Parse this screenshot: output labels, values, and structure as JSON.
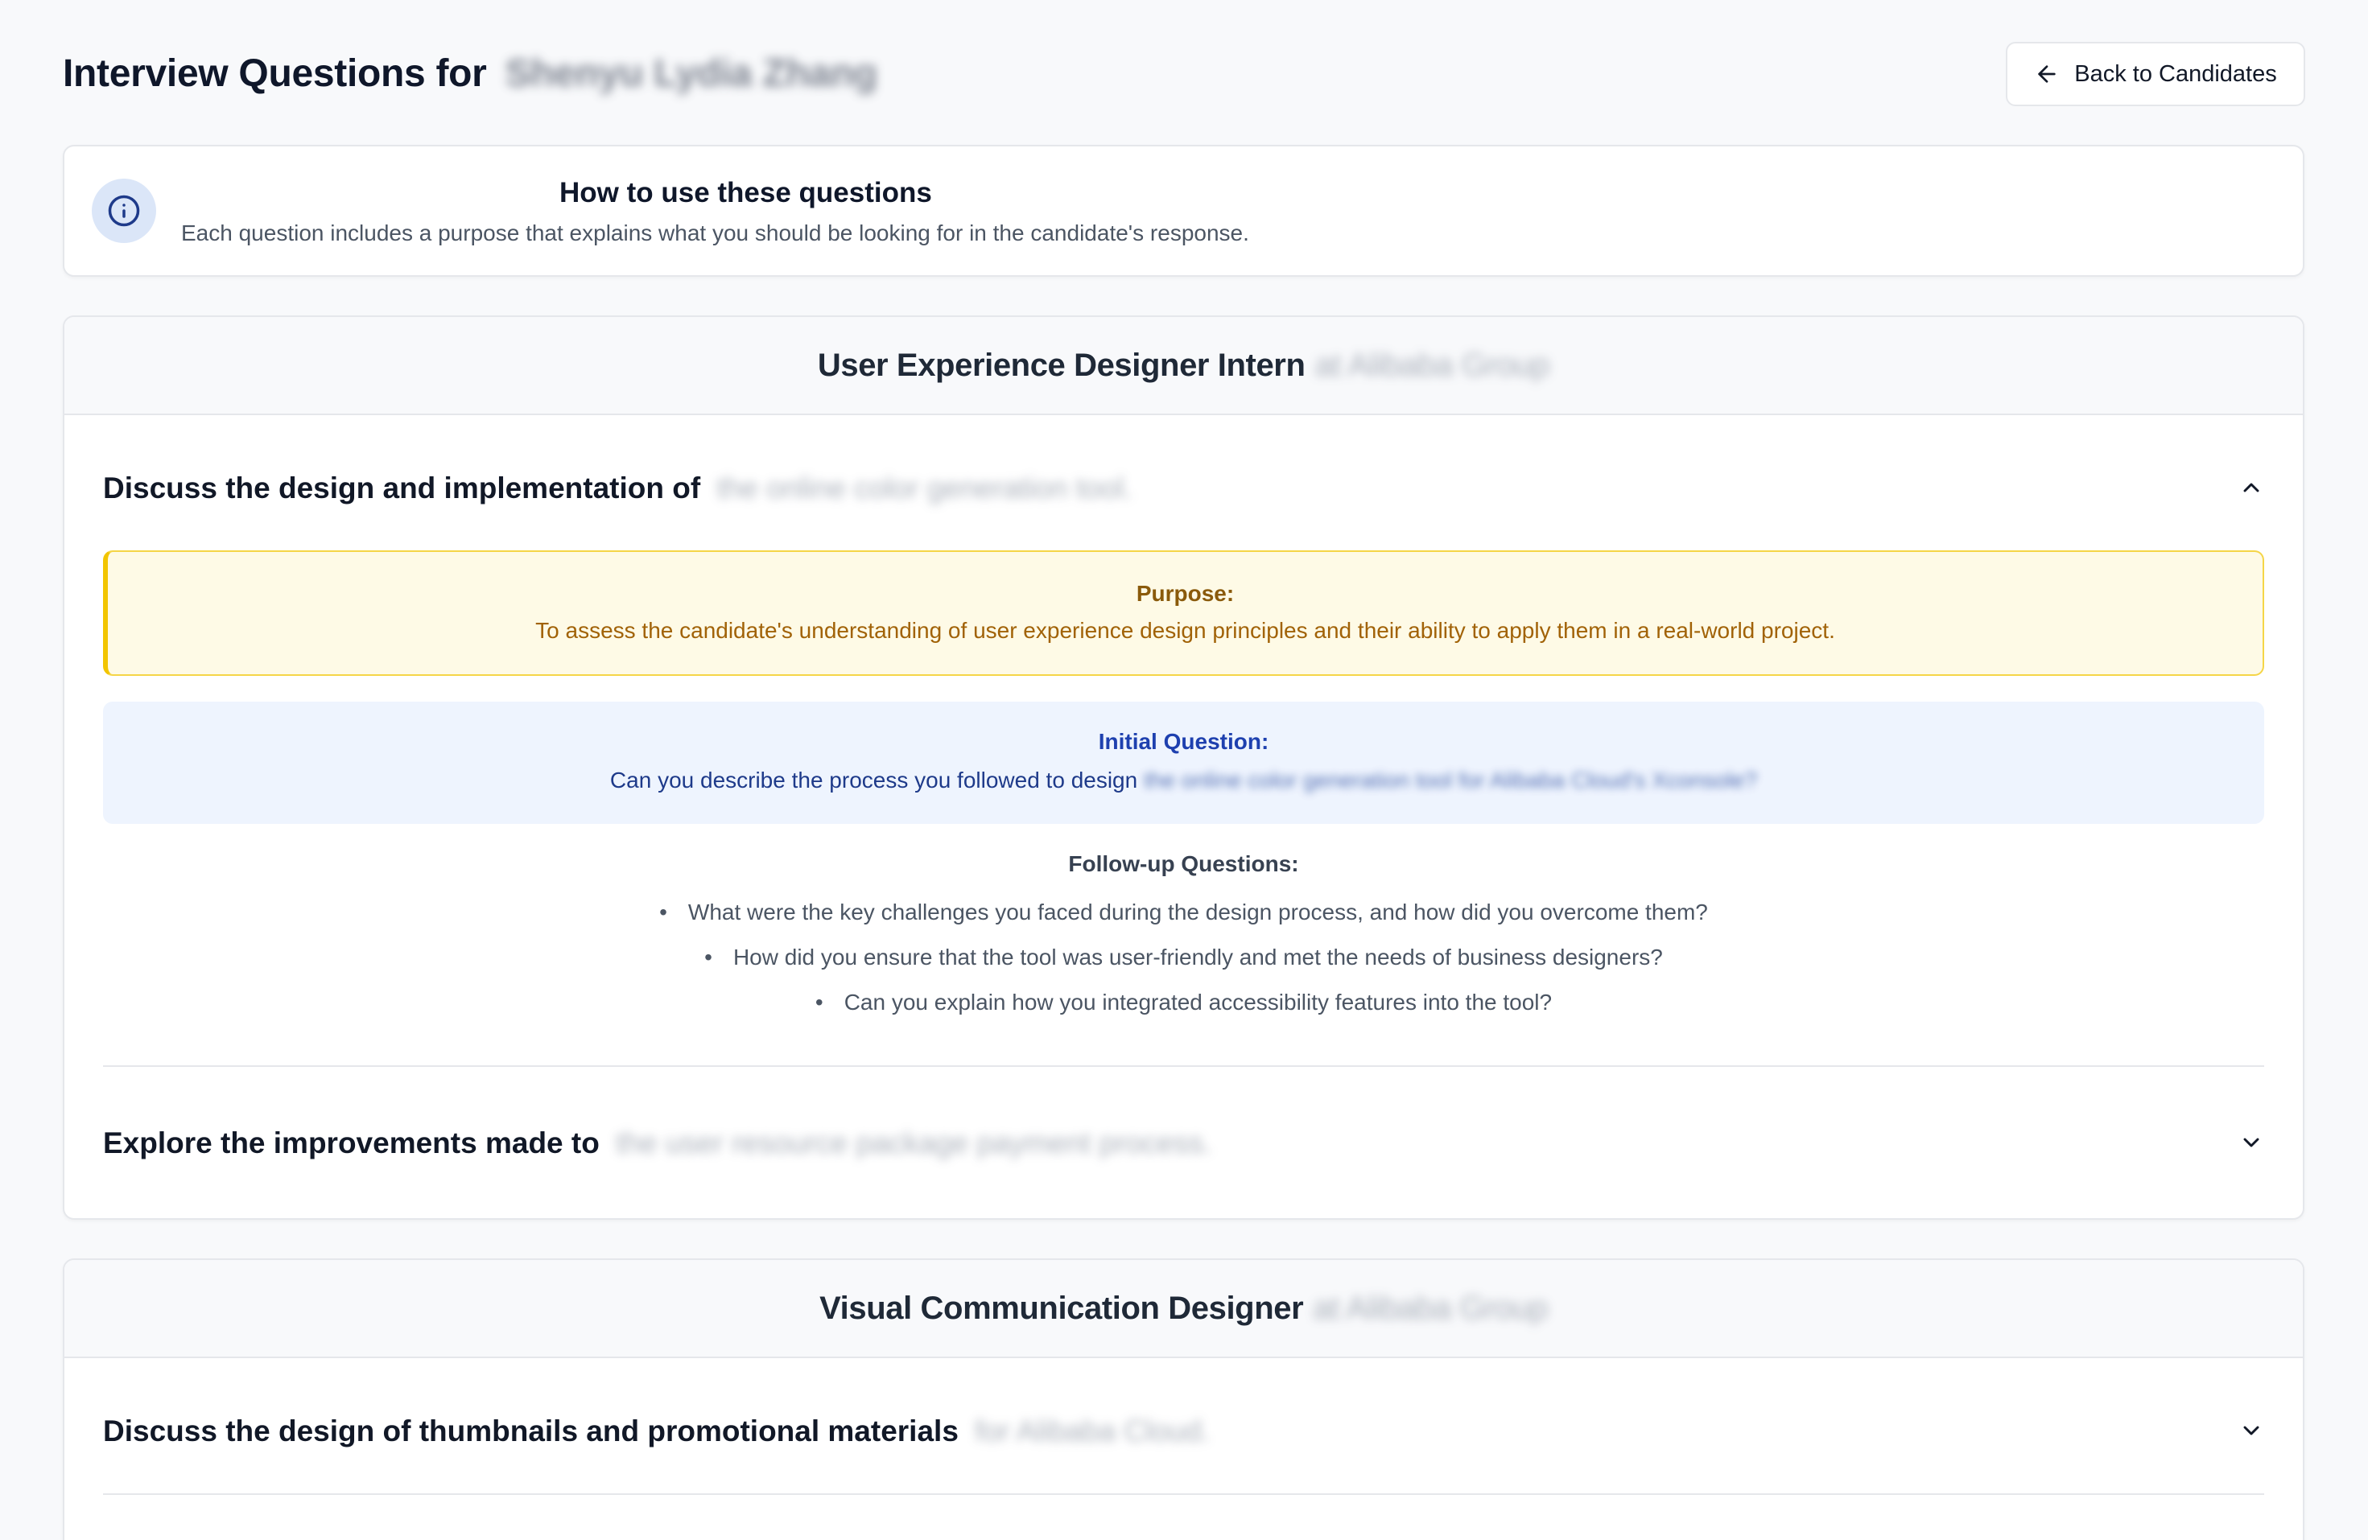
{
  "header": {
    "title_prefix": "Interview Questions for",
    "candidate_name": "Shenyu Lydia Zhang",
    "back_button_label": "Back to Candidates"
  },
  "info": {
    "icon": "info-icon",
    "title": "How to use these questions",
    "description": "Each question includes a purpose that explains what you should be looking for in the candidate's response."
  },
  "roles": [
    {
      "title": "User Experience Designer Intern",
      "company": "at Alibaba Group",
      "topics": [
        {
          "title_prefix": "Discuss the design and implementation of",
          "title_rest": "the online color generation tool.",
          "expanded": true,
          "purpose_label": "Purpose:",
          "purpose_text": "To assess the candidate's understanding of user experience design principles and their ability to apply them in a real-world project.",
          "initial_label": "Initial Question:",
          "initial_text": "Can you describe the process you followed to design",
          "initial_rest": "the online color generation tool for Alibaba Cloud's Xconsole?",
          "followup_label": "Follow-up Questions:",
          "followups": [
            "What were the key challenges you faced during the design process, and how did you overcome them?",
            "How did you ensure that the tool was user-friendly and met the needs of business designers?",
            "Can you explain how you integrated accessibility features into the tool?"
          ]
        },
        {
          "title_prefix": "Explore the improvements made to",
          "title_rest": "the user resource package payment process.",
          "expanded": false
        }
      ]
    },
    {
      "title": "Visual Communication Designer",
      "company": "at Alibaba Group",
      "topics": [
        {
          "title_prefix": "Discuss the design of thumbnails and promotional materials",
          "title_rest": "for Alibaba Cloud.",
          "expanded": false
        }
      ]
    }
  ]
}
